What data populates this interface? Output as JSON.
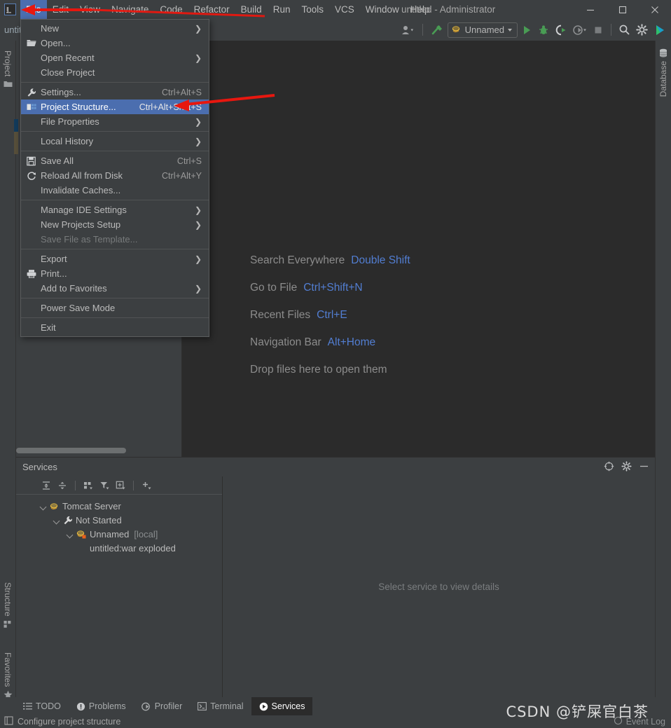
{
  "window": {
    "title": "untitled - Administrator",
    "logo_text": "IJ",
    "controls": {
      "minimize": "minimize-icon",
      "maximize": "maximize-icon",
      "close": "close-icon"
    }
  },
  "menubar": {
    "items": [
      {
        "label": "File",
        "mnemonic": "F",
        "active": true
      },
      {
        "label": "Edit",
        "mnemonic": "E",
        "active": false
      },
      {
        "label": "View",
        "mnemonic": "V",
        "active": false
      },
      {
        "label": "Navigate",
        "mnemonic": "N",
        "active": false
      },
      {
        "label": "Code",
        "mnemonic": "C",
        "active": false
      },
      {
        "label": "Refactor",
        "mnemonic": "R",
        "active": false
      },
      {
        "label": "Build",
        "mnemonic": "B",
        "active": false
      },
      {
        "label": "Run",
        "mnemonic": "u",
        "active": false
      },
      {
        "label": "Tools",
        "mnemonic": "T",
        "active": false
      },
      {
        "label": "VCS",
        "mnemonic": "S",
        "active": false
      },
      {
        "label": "Window",
        "mnemonic": "W",
        "active": false
      },
      {
        "label": "Help",
        "mnemonic": "H",
        "active": false
      }
    ]
  },
  "file_menu": {
    "items": [
      {
        "label": "New",
        "accel": "",
        "submenu": true,
        "icon": "",
        "disabled": false,
        "selected": false
      },
      {
        "label": "Open...",
        "accel": "",
        "submenu": false,
        "icon": "folder-open-icon",
        "disabled": false,
        "selected": false
      },
      {
        "label": "Open Recent",
        "accel": "",
        "submenu": true,
        "icon": "",
        "disabled": false,
        "selected": false
      },
      {
        "label": "Close Project",
        "accel": "",
        "submenu": false,
        "icon": "",
        "disabled": false,
        "selected": false
      },
      {
        "separator": true
      },
      {
        "label": "Settings...",
        "accel": "Ctrl+Alt+S",
        "submenu": false,
        "icon": "wrench-icon",
        "disabled": false,
        "selected": false
      },
      {
        "label": "Project Structure...",
        "accel": "Ctrl+Alt+Shift+S",
        "submenu": false,
        "icon": "project-structure-icon",
        "disabled": false,
        "selected": true
      },
      {
        "label": "File Properties",
        "accel": "",
        "submenu": true,
        "icon": "",
        "disabled": false,
        "selected": false
      },
      {
        "separator": true
      },
      {
        "label": "Local History",
        "accel": "",
        "submenu": true,
        "icon": "",
        "disabled": false,
        "selected": false
      },
      {
        "separator": true
      },
      {
        "label": "Save All",
        "accel": "Ctrl+S",
        "submenu": false,
        "icon": "save-icon",
        "disabled": false,
        "selected": false
      },
      {
        "label": "Reload All from Disk",
        "accel": "Ctrl+Alt+Y",
        "submenu": false,
        "icon": "reload-icon",
        "disabled": false,
        "selected": false
      },
      {
        "label": "Invalidate Caches...",
        "accel": "",
        "submenu": false,
        "icon": "",
        "disabled": false,
        "selected": false
      },
      {
        "separator": true
      },
      {
        "label": "Manage IDE Settings",
        "accel": "",
        "submenu": true,
        "icon": "",
        "disabled": false,
        "selected": false
      },
      {
        "label": "New Projects Setup",
        "accel": "",
        "submenu": true,
        "icon": "",
        "disabled": false,
        "selected": false
      },
      {
        "label": "Save File as Template...",
        "accel": "",
        "submenu": false,
        "icon": "",
        "disabled": true,
        "selected": false
      },
      {
        "separator": true
      },
      {
        "label": "Export",
        "accel": "",
        "submenu": true,
        "icon": "",
        "disabled": false,
        "selected": false
      },
      {
        "label": "Print...",
        "accel": "",
        "submenu": false,
        "icon": "print-icon",
        "disabled": false,
        "selected": false
      },
      {
        "label": "Add to Favorites",
        "accel": "",
        "submenu": true,
        "icon": "",
        "disabled": false,
        "selected": false
      },
      {
        "separator": true
      },
      {
        "label": "Power Save Mode",
        "accel": "",
        "submenu": false,
        "icon": "",
        "disabled": false,
        "selected": false
      },
      {
        "separator": true
      },
      {
        "label": "Exit",
        "accel": "",
        "submenu": false,
        "icon": "",
        "disabled": false,
        "selected": false
      }
    ]
  },
  "breadcrumb": {
    "text": "untitled"
  },
  "toolbar": {
    "user_icon": "user-settings-icon",
    "build_icon": "build-hammer-icon",
    "run_config": {
      "label": "Unnamed",
      "icon": "tomcat-icon"
    },
    "run_icon": "run-play-icon",
    "debug_icon": "debug-bug-icon",
    "run_coverage_icon": "run-with-coverage-icon",
    "profiler_icon": "profiler-icon",
    "stop_icon": "stop-icon",
    "search_icon": "search-icon",
    "settings_icon": "gear-icon",
    "ide_help_icon": "ide-assistant-icon"
  },
  "tool_strips": {
    "left_top": [
      {
        "label": "Project",
        "icon": "project-folder-icon"
      }
    ],
    "left_bottom": [
      {
        "label": "Structure",
        "icon": "structure-icon"
      },
      {
        "label": "Favorites",
        "icon": "star-icon"
      }
    ],
    "right_top": [
      {
        "label": "Database",
        "icon": "database-icon"
      }
    ]
  },
  "editor": {
    "hints": [
      {
        "label": "Search Everywhere",
        "key": "Double Shift"
      },
      {
        "label": "Go to File",
        "key": "Ctrl+Shift+N"
      },
      {
        "label": "Recent Files",
        "key": "Ctrl+E"
      },
      {
        "label": "Navigation Bar",
        "key": "Alt+Home"
      },
      {
        "label": "Drop files here to open them",
        "key": ""
      }
    ]
  },
  "services": {
    "title": "Services",
    "header_buttons": [
      {
        "name": "locate-icon",
        "label": ""
      },
      {
        "name": "gear-icon",
        "label": ""
      },
      {
        "name": "hide-icon",
        "label": ""
      }
    ],
    "toolbar_buttons": [
      {
        "name": "expand-all-icon"
      },
      {
        "name": "collapse-all-icon"
      },
      {
        "name": "group-icon"
      },
      {
        "name": "filter-icon"
      },
      {
        "name": "add-tab-icon"
      },
      {
        "name": "add-service-icon"
      }
    ],
    "tree": [
      {
        "label": "Tomcat Server",
        "suffix": "",
        "icon": "tomcat-icon",
        "depth": 0,
        "expanded": true
      },
      {
        "label": "Not Started",
        "suffix": "",
        "icon": "wrench-icon",
        "depth": 1,
        "expanded": true
      },
      {
        "label": "Unnamed",
        "suffix": "[local]",
        "icon": "tomcat-icon",
        "depth": 2,
        "expanded": true
      },
      {
        "label": "untitled:war exploded",
        "suffix": "",
        "icon": "",
        "depth": 3,
        "expanded": false
      }
    ],
    "detail_placeholder": "Select service to view details"
  },
  "bottom_tabs": [
    {
      "label": "TODO",
      "icon": "todo-icon",
      "selected": false
    },
    {
      "label": "Problems",
      "icon": "problems-icon",
      "selected": false
    },
    {
      "label": "Profiler",
      "icon": "profiler-icon",
      "selected": false
    },
    {
      "label": "Terminal",
      "icon": "terminal-icon",
      "selected": false
    },
    {
      "label": "Services",
      "icon": "services-icon",
      "selected": true
    }
  ],
  "statusbar": {
    "message": "Configure project structure",
    "icon": "status-widget-icon",
    "event_log": "Event Log",
    "event_log_icon": "event-log-icon"
  },
  "watermark": {
    "text": "CSDN @铲屎官白茶"
  },
  "colors": {
    "accent_selection": "#4b6eaf",
    "panel_bg": "#3c3f41",
    "editor_bg": "#2b2b2b",
    "hint_key": "#527ed2",
    "annotation_arrow": "#e8170f",
    "run_green": "#499c54"
  }
}
